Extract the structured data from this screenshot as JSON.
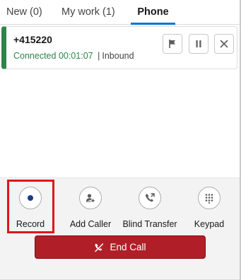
{
  "tabs": [
    {
      "label": "New (0)"
    },
    {
      "label": "My work (1)"
    },
    {
      "label": "Phone"
    }
  ],
  "call": {
    "number": "+415220",
    "status": "Connected",
    "duration": "00:01:07",
    "separator": "|",
    "direction": "Inbound"
  },
  "icons": {
    "flag": "flag-icon",
    "pause": "pause-icon",
    "close": "close-icon",
    "record": "record-icon",
    "add_caller": "add-caller-icon",
    "blind_transfer": "blind-transfer-icon",
    "keypad": "keypad-icon",
    "end_call": "end-call-icon"
  },
  "actions": {
    "record": "Record",
    "add_caller": "Add Caller",
    "blind_transfer": "Blind Transfer",
    "keypad": "Keypad"
  },
  "end_call_label": "End Call",
  "colors": {
    "connected": "#2e844a",
    "active_tab": "#0176d3",
    "end_call_bg": "#b01f28",
    "highlight": "#e1141e",
    "record_dot": "#1b3a8a"
  }
}
